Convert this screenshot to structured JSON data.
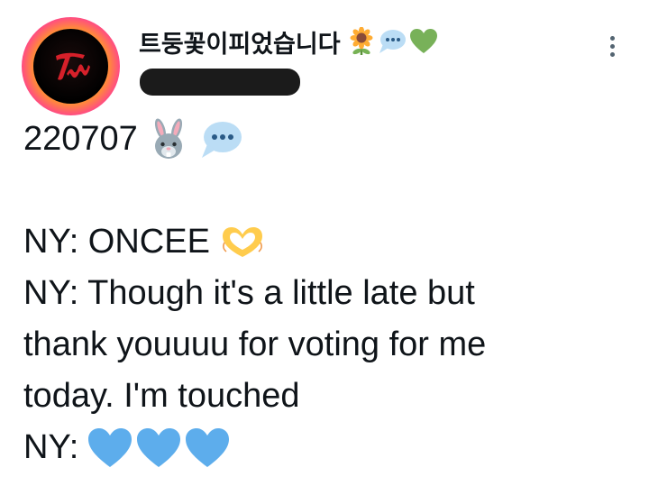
{
  "author": {
    "display_name": "트둥꽃이피었습니다",
    "name_emojis": [
      "sunflower-icon",
      "speech-bubble-icon",
      "green-heart-icon"
    ]
  },
  "tweet": {
    "line1_text": "220707",
    "line1_emojis": [
      "rabbit-face-icon",
      "speech-bubble-icon"
    ],
    "line2_text": "NY: ONCEE",
    "line2_emoji": "heart-hands-icon",
    "line3_text": "NY: Though it's a little late but",
    "line4_text": "thank youuuu for voting for me",
    "line5_text": "today. I'm touched",
    "line6_text": "NY:",
    "line6_emojis": [
      "blue-heart-icon",
      "blue-heart-icon",
      "blue-heart-icon"
    ]
  },
  "colors": {
    "text": "#0f1419",
    "avatar_ring": "#ff2ea6",
    "blue_heart": "#5dadec",
    "green_heart": "#78b159"
  }
}
